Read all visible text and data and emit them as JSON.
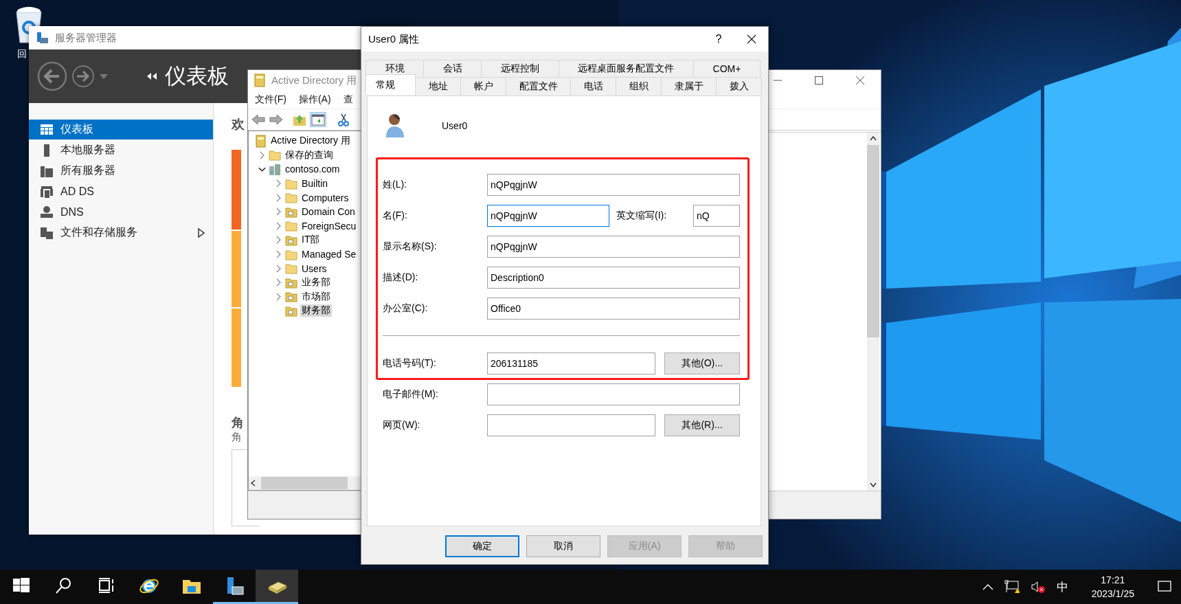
{
  "desktop": {
    "icons": [
      {
        "label": "回"
      }
    ]
  },
  "server_manager": {
    "title": "服务器管理器",
    "header": "仪表板",
    "sidebar": [
      {
        "label": "仪表板",
        "kind": "dashboard",
        "selected": true,
        "submenu": false
      },
      {
        "label": "本地服务器",
        "kind": "server",
        "selected": false,
        "submenu": false
      },
      {
        "label": "所有服务器",
        "kind": "servers",
        "selected": false,
        "submenu": false
      },
      {
        "label": "AD DS",
        "kind": "adds",
        "selected": false,
        "submenu": false
      },
      {
        "label": "DNS",
        "kind": "dns",
        "selected": false,
        "submenu": false
      },
      {
        "label": "文件和存储服务",
        "kind": "files",
        "selected": false,
        "submenu": true
      }
    ],
    "welcome_heading": "欢",
    "section_heading": "角",
    "section_subtitle": "角"
  },
  "ad_window": {
    "title": "Active Directory 用",
    "menu": [
      "文件(F)",
      "操作(A)",
      "查"
    ],
    "tree": [
      {
        "label": "Active Directory 用",
        "kind": "root",
        "selected": false,
        "children": [
          {
            "label": "保存的查询",
            "kind": "container",
            "expandable": true,
            "expanded": false,
            "selected": false
          },
          {
            "label": "contoso.com",
            "kind": "domain",
            "expandable": true,
            "expanded": true,
            "selected": false,
            "children": [
              {
                "label": "Builtin",
                "kind": "container",
                "expandable": true,
                "expanded": false,
                "selected": false
              },
              {
                "label": "Computers",
                "kind": "container",
                "expandable": true,
                "expanded": false,
                "selected": false
              },
              {
                "label": "Domain Con",
                "kind": "ou",
                "expandable": true,
                "expanded": false,
                "selected": false
              },
              {
                "label": "ForeignSecu",
                "kind": "container",
                "expandable": true,
                "expanded": false,
                "selected": false
              },
              {
                "label": "IT部",
                "kind": "ou",
                "expandable": true,
                "expanded": false,
                "selected": false
              },
              {
                "label": "Managed Se",
                "kind": "container",
                "expandable": true,
                "expanded": false,
                "selected": false
              },
              {
                "label": "Users",
                "kind": "container",
                "expandable": true,
                "expanded": false,
                "selected": false
              },
              {
                "label": "业务部",
                "kind": "ou",
                "expandable": true,
                "expanded": false,
                "selected": false
              },
              {
                "label": "市场部",
                "kind": "ou",
                "expandable": true,
                "expanded": false,
                "selected": false
              },
              {
                "label": "财务部",
                "kind": "ou",
                "selected": true
              }
            ]
          }
        ]
      }
    ]
  },
  "dialog": {
    "title": "User0 属性",
    "help": "?",
    "tabs_back": [
      {
        "label": "环境",
        "selected": false
      },
      {
        "label": "会话",
        "selected": false
      },
      {
        "label": "远程控制",
        "selected": false
      },
      {
        "label": "远程桌面服务配置文件",
        "selected": false
      },
      {
        "label": "COM+",
        "selected": false
      }
    ],
    "tabs_front": [
      {
        "label": "常规",
        "selected": true
      },
      {
        "label": "地址",
        "selected": false
      },
      {
        "label": "帐户",
        "selected": false
      },
      {
        "label": "配置文件",
        "selected": false
      },
      {
        "label": "电话",
        "selected": false
      },
      {
        "label": "组织",
        "selected": false
      },
      {
        "label": "隶属于",
        "selected": false
      },
      {
        "label": "拨入",
        "selected": false
      }
    ],
    "user_name": "User0",
    "identity_fields": [
      {
        "label": "姓(L):",
        "value": "nQPqgjnW",
        "focused": false
      },
      {
        "label": "名(F):",
        "value": "nQPqgjnW",
        "focused": true,
        "extra": {
          "label": "英文缩写(I):",
          "value": "nQ"
        }
      },
      {
        "label": "显示名称(S):",
        "value": "nQPqgjnW",
        "focused": false
      },
      {
        "label": "描述(D):",
        "value": "Description0",
        "focused": false
      },
      {
        "label": "办公室(C):",
        "value": "Office0",
        "focused": false
      }
    ],
    "contact_fields": [
      {
        "label": "电话号码(T):",
        "value": "206131185",
        "focused": false,
        "button": "其他(O)..."
      },
      {
        "label": "电子邮件(M):",
        "focused": false
      },
      {
        "label": "网页(W):",
        "focused": false,
        "button": "其他(R)..."
      }
    ],
    "buttons": [
      {
        "label": "确定",
        "default": true,
        "disabled": false
      },
      {
        "label": "取消",
        "default": false,
        "disabled": false
      },
      {
        "label": "应用(A)",
        "default": false,
        "disabled": true
      },
      {
        "label": "帮助",
        "default": false,
        "disabled": true
      }
    ]
  },
  "taskbar": {
    "apps": [
      {
        "kind": "start",
        "running": false,
        "active": false
      },
      {
        "kind": "search",
        "running": false,
        "active": false
      },
      {
        "kind": "taskview",
        "running": false,
        "active": false
      },
      {
        "kind": "browser",
        "running": false,
        "active": false
      },
      {
        "kind": "explorer",
        "running": false,
        "active": false
      },
      {
        "kind": "servermanager",
        "running": true,
        "active": false
      },
      {
        "kind": "adtool",
        "running": true,
        "active": true
      }
    ],
    "tray": {
      "ime": "中",
      "time": "17:21",
      "date": "2023/1/25"
    }
  }
}
